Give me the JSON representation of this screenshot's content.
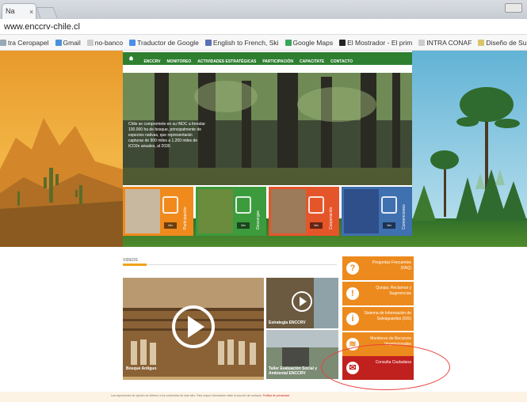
{
  "browser": {
    "tab_title": "Na",
    "tab_close": "×",
    "url": "www.enccrv-chile.cl",
    "bookmarks": [
      {
        "label": "tra Ceropapel",
        "color": "#9aa8b5"
      },
      {
        "label": "Gmail",
        "color": "#4a90d9"
      },
      {
        "label": "no-banco",
        "color": "#cccccc"
      },
      {
        "label": "Traductor de Google",
        "color": "#4a8ee8"
      },
      {
        "label": "English to French, Ski",
        "color": "#5b6fb5"
      },
      {
        "label": "Google Maps",
        "color": "#3ba55c"
      },
      {
        "label": "El Mostrador - El prim",
        "color": "#222222"
      },
      {
        "label": "INTRA CONAF",
        "color": "#cccccc"
      },
      {
        "label": "Diseño de SurveyMo",
        "color": "#d9c56a"
      }
    ]
  },
  "site": {
    "nav": [
      "ENCCRV",
      "MONITOREO",
      "ACTIVIDADES ESTRATÉGICAS",
      "PARTICIPACIÓN",
      "CAPACITATE",
      "CONTACTO"
    ],
    "slider_text": "Chile se compromete en su INDC a forestar 100.000 ha de bosque, principalmente de especies nativas, que representarán capturas de 900 miles a 1.200 miles de tCO2e anuales, al 2030.",
    "tiles": [
      {
        "label": "Participación",
        "button": "Ver",
        "color": "#f08a1d"
      },
      {
        "label": "Descargas",
        "button": "Ver",
        "color": "#3c9b3c"
      },
      {
        "label": "Cooperación",
        "button": "Ver",
        "color": "#e5552a"
      },
      {
        "label": "Convenciones",
        "button": "Ver",
        "color": "#3f70b0"
      }
    ],
    "videos": {
      "title": "VIDEOS",
      "main_caption": "Bosque Antiguo",
      "small_1_caption": "Estrategia ENCCRV",
      "small_2_caption": "Taller Evaluación Social y Ambiental ENCCRV"
    },
    "side_buttons": [
      {
        "label": "Preguntas Frecuentes (FAQ)",
        "icon": "?",
        "style": "orange"
      },
      {
        "label": "Quejas, Reclamos y Sugerencias",
        "icon": "!",
        "style": "orange"
      },
      {
        "label": "Sistema de Información de Salvaguardas (SIS)",
        "icon": "i",
        "style": "orange"
      },
      {
        "label": "Monitoreo de Recursos Vegetacionales",
        "icon": "≋",
        "style": "orange"
      },
      {
        "label": "Consulta Ciudadana",
        "icon": "✉",
        "style": "red"
      }
    ],
    "footer_text": "Las expresiones de opinión se refieren a los contenidos de este sitio. Para mayor información visite la sección de contacto.",
    "footer_link": "Política de privacidad"
  }
}
